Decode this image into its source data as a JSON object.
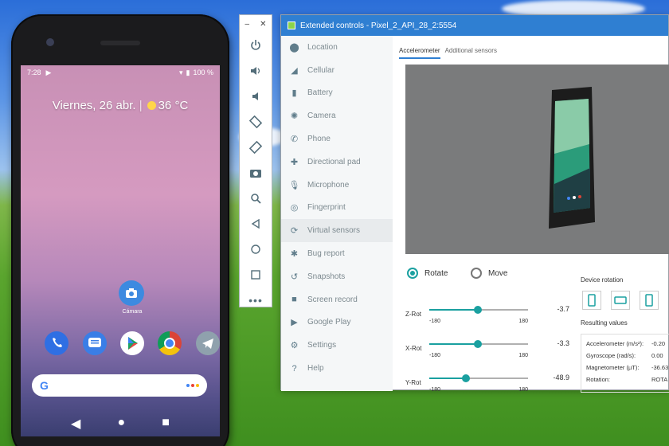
{
  "phone": {
    "status_time": "7:28",
    "battery": "100 %",
    "date": "Viernes, 26 abr.",
    "temp": "36 °C",
    "camera_label": "Cámara"
  },
  "window": {
    "title": "Extended controls - Pixel_2_API_28_2:5554"
  },
  "sidebar": {
    "items": [
      {
        "label": "Location",
        "icon": "location-icon"
      },
      {
        "label": "Cellular",
        "icon": "cellular-icon"
      },
      {
        "label": "Battery",
        "icon": "battery-icon"
      },
      {
        "label": "Camera",
        "icon": "camera-icon"
      },
      {
        "label": "Phone",
        "icon": "phone-icon"
      },
      {
        "label": "Directional pad",
        "icon": "dpad-icon"
      },
      {
        "label": "Microphone",
        "icon": "microphone-icon"
      },
      {
        "label": "Fingerprint",
        "icon": "fingerprint-icon"
      },
      {
        "label": "Virtual sensors",
        "icon": "sensors-icon"
      },
      {
        "label": "Bug report",
        "icon": "bug-icon"
      },
      {
        "label": "Snapshots",
        "icon": "snapshots-icon"
      },
      {
        "label": "Screen record",
        "icon": "record-icon"
      },
      {
        "label": "Google Play",
        "icon": "play-icon"
      },
      {
        "label": "Settings",
        "icon": "settings-icon"
      },
      {
        "label": "Help",
        "icon": "help-icon"
      }
    ]
  },
  "tabs": {
    "accelerometer": "Accelerometer",
    "additional": "Additional sensors"
  },
  "mode": {
    "rotate": "Rotate",
    "move": "Move"
  },
  "sliders": [
    {
      "label": "Z-Rot",
      "value": "-3.7",
      "min": "-180",
      "max": "180",
      "level": 0.49
    },
    {
      "label": "X-Rot",
      "value": "-3.3",
      "min": "-180",
      "max": "180",
      "level": 0.49
    },
    {
      "label": "Y-Rot",
      "value": "-48.9",
      "min": "-180",
      "max": "180",
      "level": 0.37
    }
  ],
  "device_rotation": "Device rotation",
  "results": {
    "title": "Resulting values",
    "rows": [
      {
        "k": "Accelerometer (m/s²):",
        "v": "-0.20"
      },
      {
        "k": "Gyroscope (rad/s):",
        "v": "0.00"
      },
      {
        "k": "Magnetometer (µT):",
        "v": "-36.63"
      },
      {
        "k": "Rotation:",
        "v": "ROTA"
      }
    ]
  }
}
